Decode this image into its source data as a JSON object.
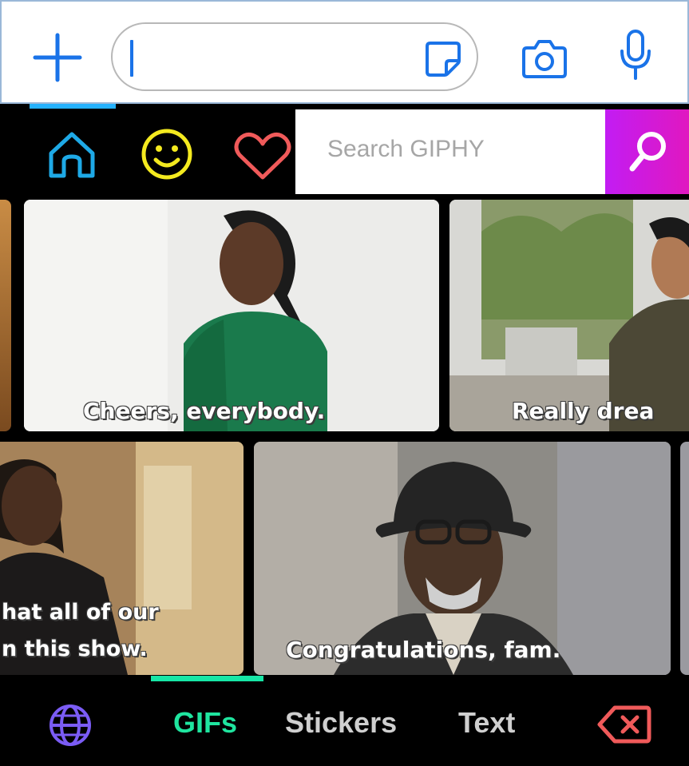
{
  "composer": {
    "input_value": "",
    "icons": [
      "plus-icon",
      "sticker-icon",
      "camera-icon",
      "microphone-icon"
    ]
  },
  "giphy": {
    "nav_icons": [
      "home-icon",
      "smile-icon",
      "heart-icon"
    ],
    "search_placeholder": "Search GIPHY",
    "search_button_icon": "search-icon",
    "colors": {
      "home": "#1ea9e6",
      "smile": "#f4ea1f",
      "heart": "#f05a5a",
      "search_button": "#c21cf3",
      "active_tab": "#1fe59f"
    }
  },
  "gifs": [
    {
      "caption": "Cheers, everybody."
    },
    {
      "caption": "Really drea"
    },
    {
      "caption_line1": "hat all of our",
      "caption_line2": "n this show."
    },
    {
      "caption": "Congratulations, fam."
    }
  ],
  "tabs": {
    "gifs": "GIFs",
    "stickers": "Stickers",
    "text": "Text",
    "active": "GIFs"
  },
  "bottom_icons": [
    "globe-icon",
    "backspace-icon"
  ]
}
